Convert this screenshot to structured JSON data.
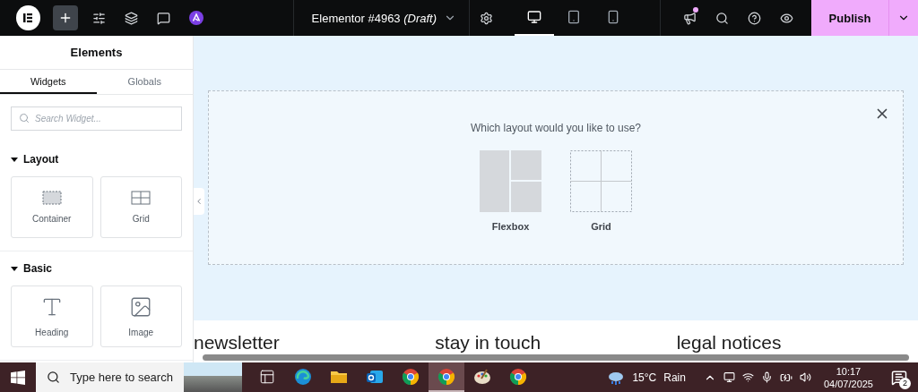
{
  "topbar": {
    "title": "Elementor #4963 *(Draft)*",
    "devices": [
      {
        "kind": "desktop",
        "selected": true
      },
      {
        "kind": "tablet",
        "selected": false
      },
      {
        "kind": "mobile",
        "selected": false
      }
    ],
    "has_notification": true,
    "publish": "Publish"
  },
  "sidebar": {
    "title": "Elements",
    "tabs": [
      {
        "label": "Widgets",
        "selected": true
      },
      {
        "label": "Globals",
        "selected": false
      }
    ],
    "search": {
      "placeholder": "Search Widget..."
    },
    "sections": [
      {
        "title": "Layout",
        "expanded": true,
        "widgets": [
          {
            "kind": "container",
            "label": "Container"
          },
          {
            "kind": "grid",
            "label": "Grid"
          }
        ]
      },
      {
        "title": "Basic",
        "expanded": true,
        "widgets": [
          {
            "kind": "heading",
            "label": "Heading"
          },
          {
            "kind": "image",
            "label": "Image"
          }
        ]
      }
    ]
  },
  "canvas": {
    "prompt": "Which layout would you like to use?",
    "options": [
      {
        "kind": "flexbox",
        "label": "Flexbox"
      },
      {
        "kind": "grid",
        "label": "Grid"
      }
    ],
    "footer_headings": [
      "newsletter",
      "stay in touch",
      "legal notices"
    ]
  },
  "taskbar": {
    "search": {
      "placeholder": "Type here to search"
    },
    "apps": [
      {
        "kind": "taskview",
        "active": false
      },
      {
        "kind": "edge",
        "active": false
      },
      {
        "kind": "folder",
        "active": false
      },
      {
        "kind": "outlook",
        "active": false
      },
      {
        "kind": "chrome",
        "active": false
      },
      {
        "kind": "chrome",
        "active": true
      },
      {
        "kind": "paint",
        "active": false
      },
      {
        "kind": "chrome",
        "active": false
      }
    ],
    "temperature": "15°C",
    "weather": "Rain",
    "time": "10:17",
    "date": "04/07/2025",
    "notifications": "2"
  }
}
